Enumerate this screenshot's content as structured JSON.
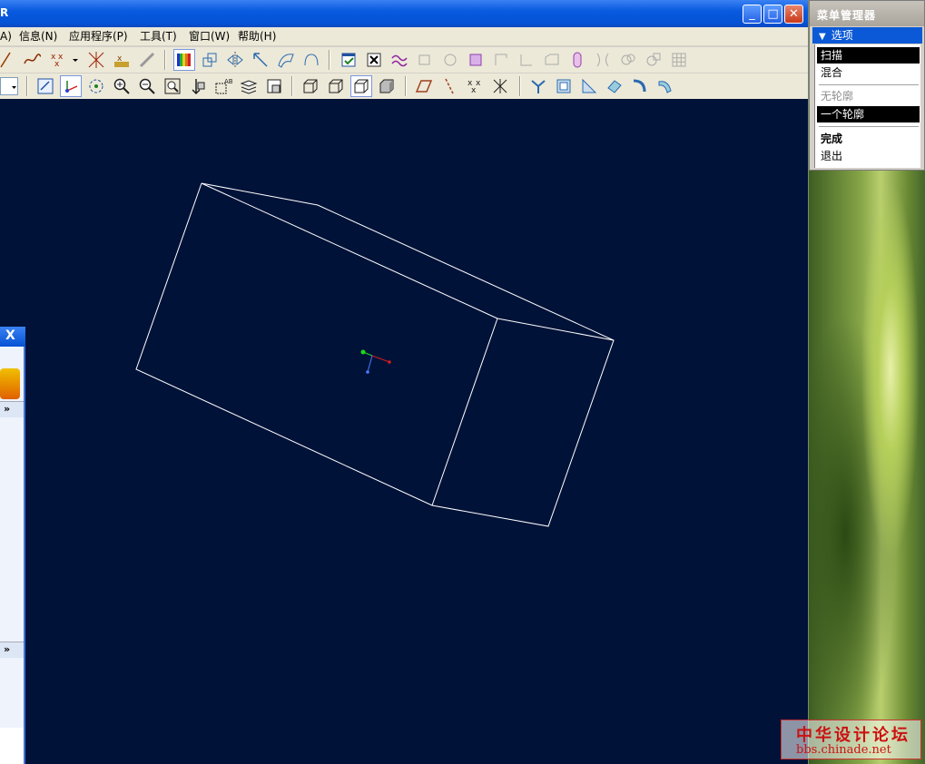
{
  "window": {
    "title_fragment": "R"
  },
  "menubar": {
    "items": [
      {
        "label": "A)"
      },
      {
        "label": "信息(N)"
      },
      {
        "label": "应用程序(P)"
      },
      {
        "label": "工具(T)"
      },
      {
        "label": "窗口(W)"
      },
      {
        "label": "帮助(H)"
      }
    ]
  },
  "toolbars": {
    "row1_icons": [
      "line-icon",
      "spline-icon",
      "point-icon",
      "dropdown-arrow-icon",
      "datum-point-icon",
      "coordinate-system-icon",
      "analysis-curve-icon",
      "color-appearance-icon",
      "copy-icon",
      "mirror-icon",
      "move-icon",
      "surface-icon",
      "boundary-icon",
      "feature-check-icon",
      "cancel-feature-icon",
      "sketch-icon",
      "extrude-icon",
      "revolve-icon",
      "sweep-icon",
      "hole-icon",
      "round-icon",
      "chamfer-icon",
      "shell-icon",
      "rib-icon",
      "draft-icon",
      "pattern-icon",
      "merge-icon",
      "grid-icon"
    ],
    "row2_icons": [
      "dropdown-arrow-icon",
      "repaint-icon",
      "spin-center-icon",
      "orient-icon",
      "zoom-in-icon",
      "zoom-out-icon",
      "refit-icon",
      "view-orient-icon",
      "saved-views-icon",
      "layers-icon",
      "view-manager-icon",
      "wireframe-icon",
      "hidden-line-icon",
      "no-hidden-icon",
      "shading-icon",
      "datum-planes-icon",
      "datum-axes-icon",
      "datum-points-icon",
      "csys-icon",
      "trim-icon",
      "offset-icon",
      "tangent-icon",
      "extend-icon",
      "thicken-icon",
      "solidify-icon"
    ]
  },
  "menu_manager": {
    "title": "菜单管理器",
    "section_label": "选项",
    "items": [
      {
        "label": "扫描",
        "state": "selected"
      },
      {
        "label": "混合",
        "state": "normal"
      },
      {
        "label": "无轮廓",
        "state": "disabled"
      },
      {
        "label": "一个轮廓",
        "state": "selected"
      },
      {
        "label": "完成",
        "state": "bold"
      },
      {
        "label": "退出",
        "state": "normal"
      }
    ]
  },
  "left_panel": {
    "close_label": "X",
    "chevron_label": "»"
  },
  "watermark": {
    "line1": "中华设计论坛",
    "line2": "bbs.chinade.net"
  },
  "colors": {
    "graphics_background": "#001238",
    "wireframe": "#ffffff",
    "menu_highlight": "#0b59d6",
    "axis_x": "#d81c1c",
    "axis_y": "#1ed81c",
    "axis_z": "#4a7cff"
  }
}
